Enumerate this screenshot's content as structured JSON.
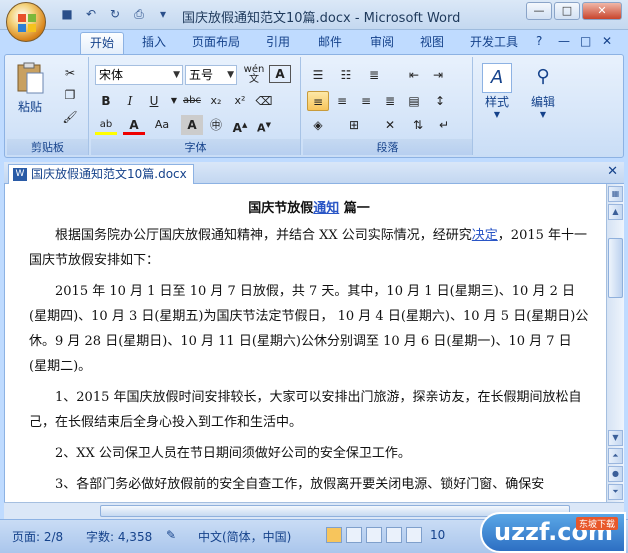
{
  "window": {
    "title": "国庆放假通知范文10篇.docx - Microsoft Word"
  },
  "ribbon_tabs": [
    "开始",
    "插入",
    "页面布局",
    "引用",
    "邮件",
    "审阅",
    "视图",
    "开发工具"
  ],
  "clipboard": {
    "paste": "粘贴",
    "label": "剪贴板"
  },
  "font": {
    "name": "宋体",
    "size": "五号",
    "wen": "wén",
    "label": "字体"
  },
  "paragraph": {
    "label": "段落"
  },
  "styles": {
    "label": "样式"
  },
  "editing": {
    "label": "编辑"
  },
  "document_tab": "国庆放假通知范文10篇.docx",
  "document": {
    "title_pre": "国庆节放假",
    "title_link": "通知",
    "title_post": " 篇一",
    "p1_pre": "根据国务院办公厅国庆放假通知精神，并结合 XX 公司实际情况，经研究",
    "p1_link": "决定",
    "p1_post": "，2015 年十一国庆节放假安排如下：",
    "p2": "2015 年 10 月 1 日至 10 月 7 日放假，共 7 天。其中，10 月 1 日(星期三)、10 月 2 日(星期四)、10 月 3 日(星期五)为国庆节法定节假日， 10 月 4 日(星期六)、10 月 5 日(星期日)公休。9 月 28 日(星期日)、10 月 11 日(星期六)公休分别调至 10 月 6 日(星期一)、10 月 7 日(星期二)。",
    "p3": "1、2015 年国庆放假时间安排较长，大家可以安排出门旅游，探亲访友，在长假期间放松自己，在长假结束后全身心投入到工作和生活中。",
    "p4": "2、XX 公司保卫人员在节日期间须做好公司的安全保卫工作。",
    "p5": "3、各部门务必做好放假前的安全自查工作，放假离开要关闭电源、锁好门窗、确保安"
  },
  "status": {
    "page": "页面: 2/8",
    "words": "字数: 4,358",
    "language": "中文(简体，中国)",
    "zoom": "10"
  },
  "watermark": {
    "main": "uzzf.com",
    "sub": "东坡下载"
  }
}
